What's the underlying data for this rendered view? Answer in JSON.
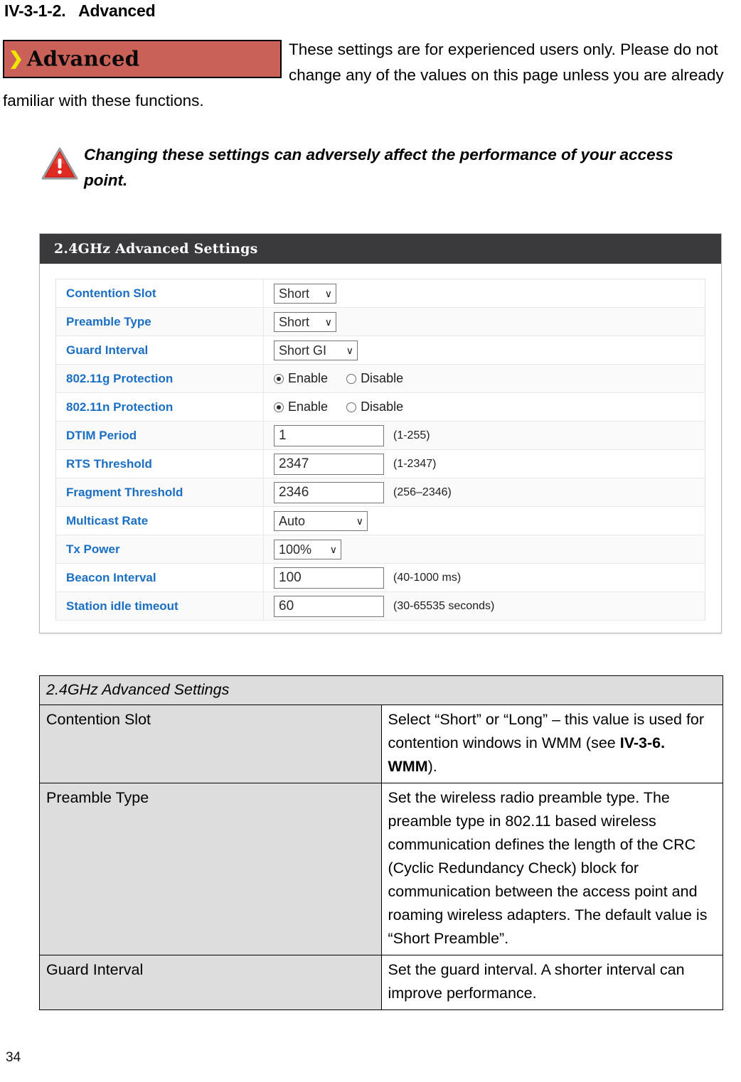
{
  "heading": "IV-3-1-2.   Advanced",
  "advanced_button": {
    "chevron": "chevron-right-icon",
    "label": "Advanced"
  },
  "intro_text": "These settings are for experienced users only. Please do not change any of the values on this page unless you are already familiar with these functions.",
  "warning": {
    "icon": "warning-triangle-icon",
    "text": "Changing these settings can adversely affect the performance of your access point."
  },
  "panel": {
    "title": "2.4GHz Advanced Settings",
    "rows": [
      {
        "label": "Contention Slot",
        "type": "select",
        "value": "Short",
        "width": "sel-w-short"
      },
      {
        "label": "Preamble Type",
        "type": "select",
        "value": "Short",
        "width": "sel-w-short"
      },
      {
        "label": "Guard Interval",
        "type": "select",
        "value": "Short GI",
        "width": "sel-w-gi"
      },
      {
        "label": "802.11g Protection",
        "type": "radio",
        "options": [
          "Enable",
          "Disable"
        ],
        "selected": "Enable"
      },
      {
        "label": "802.11n Protection",
        "type": "radio",
        "options": [
          "Enable",
          "Disable"
        ],
        "selected": "Enable"
      },
      {
        "label": "DTIM Period",
        "type": "input",
        "value": "1",
        "hint": "(1-255)"
      },
      {
        "label": "RTS Threshold",
        "type": "input",
        "value": "2347",
        "hint": "(1-2347)"
      },
      {
        "label": "Fragment Threshold",
        "type": "input",
        "value": "2346",
        "hint": "(256–2346)"
      },
      {
        "label": "Multicast Rate",
        "type": "select",
        "value": "Auto",
        "width": "sel-w-auto"
      },
      {
        "label": "Tx Power",
        "type": "select",
        "value": "100%",
        "width": "sel-w-pct"
      },
      {
        "label": "Beacon Interval",
        "type": "input",
        "value": "100",
        "hint": "(40-1000 ms)"
      },
      {
        "label": "Station idle timeout",
        "type": "input",
        "value": "60",
        "hint": "(30-65535 seconds)"
      }
    ]
  },
  "explanation_table": {
    "header": "2.4GHz Advanced Settings",
    "rows": [
      {
        "term": "Contention Slot",
        "desc_pre": "Select “Short” or “Long” – this value is used for contention windows in WMM (see ",
        "desc_bold": "IV-3-6. WMM",
        "desc_post": ")."
      },
      {
        "term": "Preamble Type",
        "desc_pre": "Set the wireless radio preamble type. The preamble type in 802.11 based wireless communication defines the length of the CRC (Cyclic Redundancy Check) block for communication between the access point and roaming wireless adapters. The default value is “Short Preamble”.",
        "desc_bold": "",
        "desc_post": ""
      },
      {
        "term": "Guard Interval",
        "desc_pre": "Set the guard interval. A shorter interval can improve performance.",
        "desc_bold": "",
        "desc_post": ""
      }
    ]
  },
  "page_number": "34"
}
